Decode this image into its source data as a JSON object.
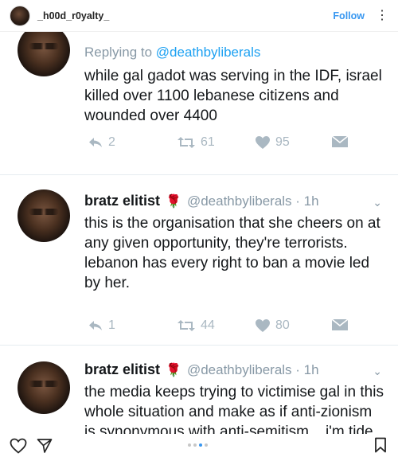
{
  "header": {
    "username": "_h00d_r0yalty_",
    "follow_label": "Follow",
    "more_icon": "more-vertical-icon"
  },
  "tweets": [
    {
      "reply_label": "Replying to",
      "reply_handle": "@deathbyliberals",
      "text": "while gal gadot was serving in the IDF, israel killed over 1100 lebanese citizens and wounded over 4400",
      "replies": "2",
      "retweets": "61",
      "likes": "95"
    },
    {
      "name": "bratz elitist",
      "emoji": "🌹",
      "handle": "@deathbyliberals · 1h",
      "text": "this is the organisation that she cheers on at any given opportunity, they're terrorists. lebanon has every right to ban a movie led by her.",
      "replies": "1",
      "retweets": "44",
      "likes": "80"
    },
    {
      "name": "bratz elitist",
      "emoji": "🌹",
      "handle": "@deathbyliberals · 1h",
      "text": "the media keeps trying to victimise gal in this whole situation and make as if anti-zionism is synonymous with anti-semitism... i'm tide"
    }
  ],
  "colors": {
    "twitter_blue": "#1da1f2",
    "twitter_gray": "#8899a6",
    "instagram_blue": "#3897f0"
  },
  "carousel": {
    "count": 4,
    "active_index": 2
  }
}
